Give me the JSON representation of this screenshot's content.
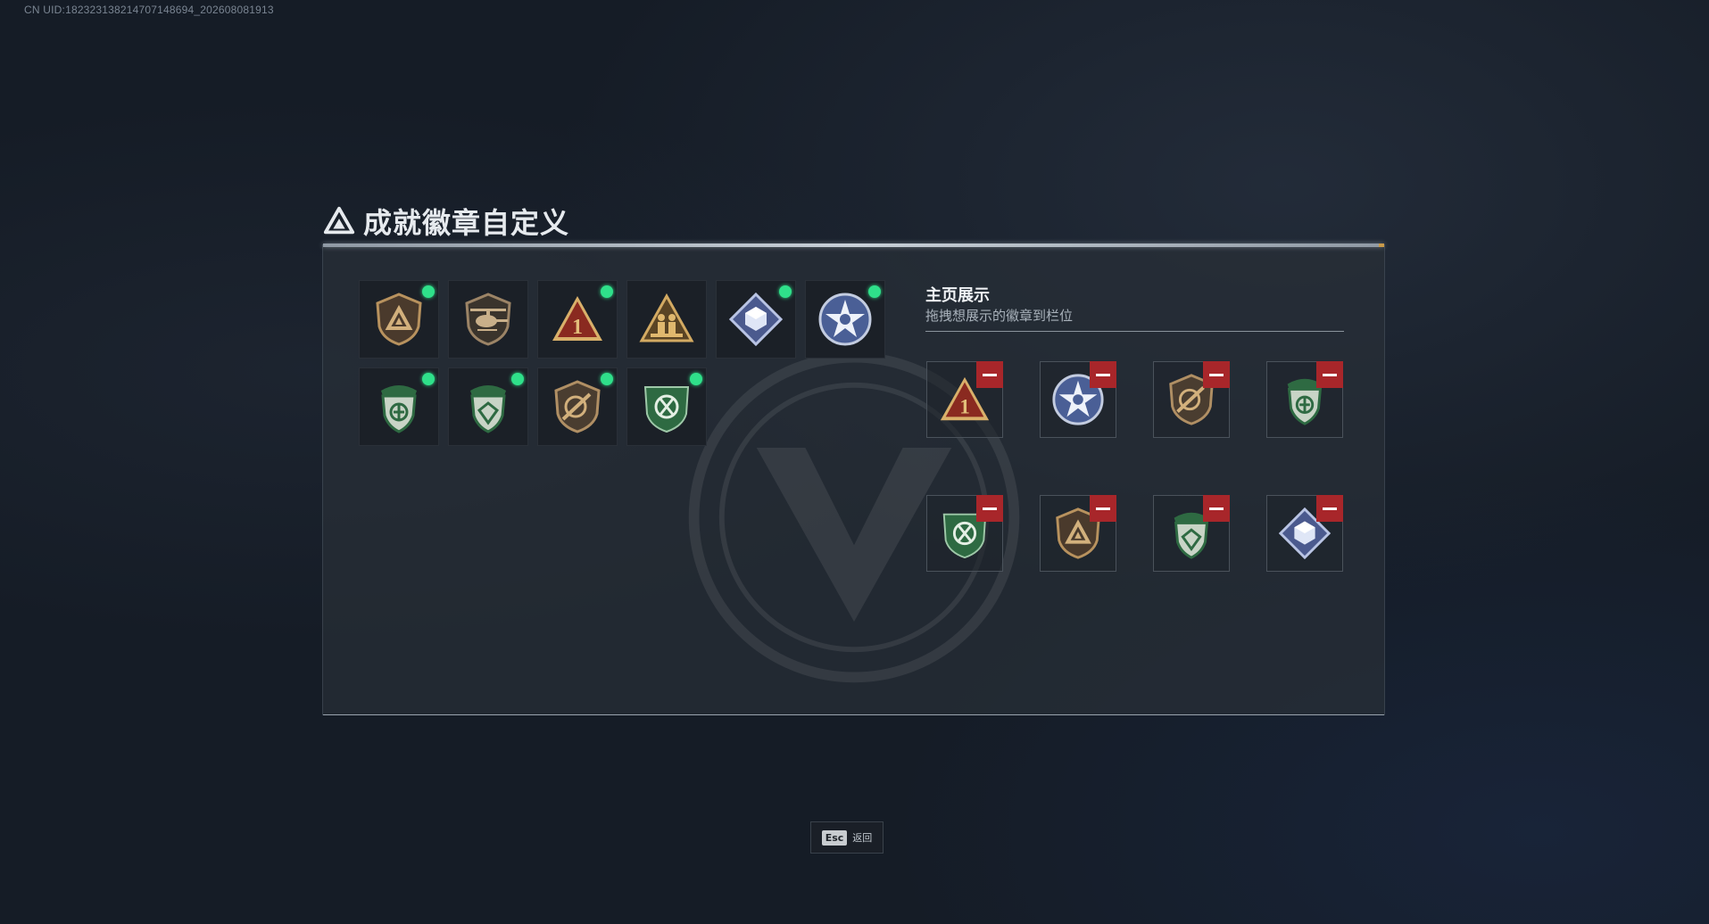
{
  "uid_text": "CN UID:1823231382147071486­94_202608081913",
  "title": {
    "text": "成就徽章自定义",
    "icon": "triangle-logo-icon"
  },
  "owned_badges": [
    {
      "id": "b1",
      "icon": "bronze-shield-triangle-badge-icon",
      "is_new": true
    },
    {
      "id": "b2",
      "icon": "helicopter-badge-icon",
      "is_new": false
    },
    {
      "id": "b3",
      "icon": "red-triangle-number-one-badge-icon",
      "is_new": true
    },
    {
      "id": "b4",
      "icon": "gold-soldiers-triangle-badge-icon",
      "is_new": false
    },
    {
      "id": "b5",
      "icon": "blue-diamond-crate-badge-icon",
      "is_new": true
    },
    {
      "id": "b6",
      "icon": "silver-star-wreath-badge-icon",
      "is_new": true
    },
    {
      "id": "b7",
      "icon": "green-beret-shield-arrows-badge-icon",
      "is_new": true
    },
    {
      "id": "b8",
      "icon": "green-beret-shield-gem-badge-icon",
      "is_new": true
    },
    {
      "id": "b9",
      "icon": "bronze-shield-rifle-badge-icon",
      "is_new": true
    },
    {
      "id": "b10",
      "icon": "green-shield-recycle-badge-icon",
      "is_new": true
    }
  ],
  "showcase": {
    "title": "主页展示",
    "subtitle": "拖拽想展示的徽章到栏位",
    "slots": [
      {
        "icon": "red-triangle-number-one-badge-icon"
      },
      {
        "icon": "silver-star-wreath-badge-icon"
      },
      {
        "icon": "bronze-shield-rifle-badge-icon"
      },
      {
        "icon": "green-beret-shield-arrows-badge-icon"
      },
      {
        "icon": "green-shield-recycle-badge-icon"
      },
      {
        "icon": "bronze-shield-triangle-badge-icon"
      },
      {
        "icon": "green-beret-shield-gem-badge-icon"
      },
      {
        "icon": "blue-diamond-crate-badge-icon"
      }
    ]
  },
  "footer": {
    "key": "Esc",
    "label": "返回"
  },
  "colors": {
    "new_dot": "#2fe08a",
    "remove": "#a8262a",
    "panel_bg": "#282f38"
  }
}
